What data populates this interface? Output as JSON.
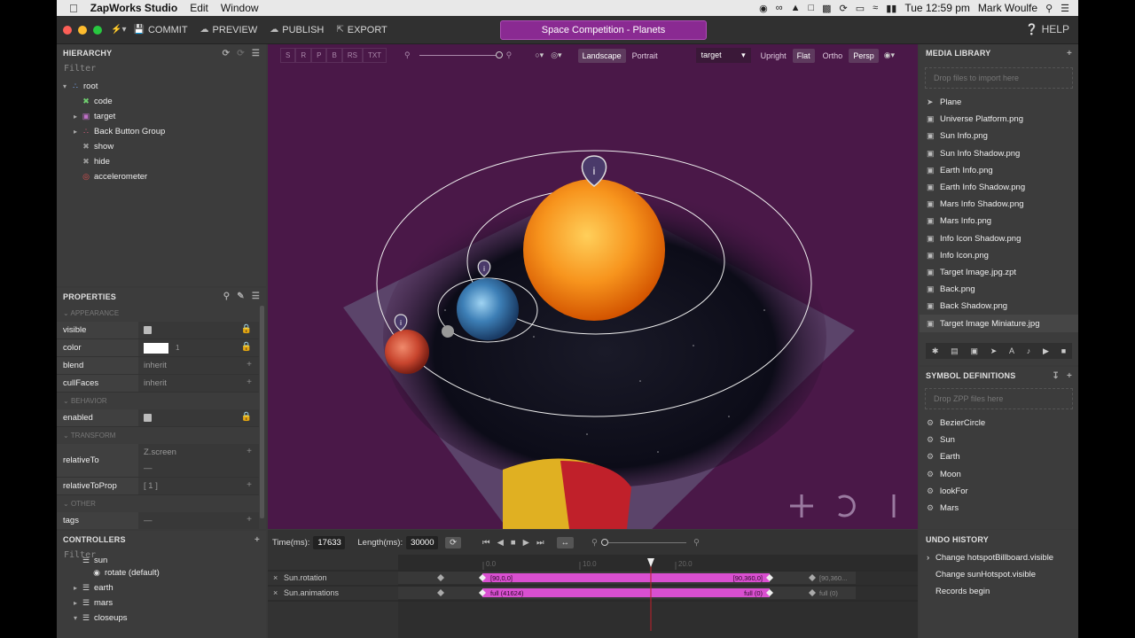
{
  "menubar": {
    "app_name": "ZapWorks Studio",
    "menus": [
      "Edit",
      "Window"
    ],
    "clock": "Tue 12:59 pm",
    "user": "Mark Woulfe"
  },
  "toolbar": {
    "commit": "COMMIT",
    "preview": "PREVIEW",
    "publish": "PUBLISH",
    "export": "EXPORT",
    "project_title": "Space Competition - Planets",
    "help": "HELP"
  },
  "hierarchy": {
    "title": "HIERARCHY",
    "filter": "Filter",
    "items": [
      {
        "label": "root",
        "icon": "group-icon",
        "color": "#7fb0ff",
        "indent": 0,
        "expanded": true
      },
      {
        "label": "code",
        "icon": "script-icon",
        "color": "#6fcf6f",
        "indent": 1
      },
      {
        "label": "target",
        "icon": "target-icon",
        "color": "#c070c8",
        "indent": 1,
        "collapsed": true
      },
      {
        "label": "Back Button Group",
        "icon": "group-icon",
        "color": "#e06080",
        "indent": 1,
        "collapsed": true
      },
      {
        "label": "show",
        "icon": "script-icon",
        "color": "#999999",
        "indent": 1
      },
      {
        "label": "hide",
        "icon": "script-icon",
        "color": "#999999",
        "indent": 1
      },
      {
        "label": "accelerometer",
        "icon": "sensor-icon",
        "color": "#e05050",
        "indent": 1
      }
    ]
  },
  "properties": {
    "title": "PROPERTIES",
    "appearance": "APPEARANCE",
    "visible": "visible",
    "color": "color",
    "color_value": "1",
    "blend": "blend",
    "blend_value": "inherit",
    "cullFaces": "cullFaces",
    "cullFaces_value": "inherit",
    "behavior": "BEHAVIOR",
    "enabled": "enabled",
    "transform": "TRANSFORM",
    "relativeTo": "relativeTo",
    "relativeTo_value": "Z.screen",
    "relativeTo_value2": "—",
    "relativeToProp": "relativeToProp",
    "relativeToProp_value": "[ 1 ]",
    "other": "OTHER",
    "tags": "tags",
    "tags_value": "—"
  },
  "controllers": {
    "title": "CONTROLLERS",
    "filter": "Filter",
    "items": [
      {
        "label": "sun",
        "indent": 1
      },
      {
        "label": "rotate (default)",
        "indent": 2
      },
      {
        "label": "earth",
        "indent": 1
      },
      {
        "label": "mars",
        "indent": 1
      },
      {
        "label": "closeups",
        "indent": 1
      }
    ]
  },
  "viewport": {
    "buttons_disabled": [
      "S",
      "R",
      "P",
      "B",
      "RS",
      "TXT"
    ],
    "landscape": "Landscape",
    "portrait": "Portrait",
    "target": "target",
    "upright": "Upright",
    "flat": "Flat",
    "ortho": "Ortho",
    "persp": "Persp"
  },
  "media": {
    "title": "MEDIA LIBRARY",
    "drop": "Drop files to import here",
    "items": [
      "Plane",
      "Universe Platform.png",
      "Sun Info.png",
      "Sun Info Shadow.png",
      "Earth Info.png",
      "Earth Info Shadow.png",
      "Mars Info Shadow.png",
      "Mars Info.png",
      "Info Icon Shadow.png",
      "Info Icon.png",
      "Target Image.jpg.zpt",
      "Back.png",
      "Back Shadow.png",
      "Target Image Miniature.jpg"
    ]
  },
  "symbols": {
    "title": "SYMBOL DEFINITIONS",
    "drop": "Drop ZPP files here",
    "items": [
      "BezierCircle",
      "Sun",
      "Earth",
      "Moon",
      "lookFor",
      "Mars"
    ]
  },
  "timeline": {
    "time_label": "Time(ms):",
    "time_value": "17633",
    "length_label": "Length(ms):",
    "length_value": "30000",
    "ticks": [
      "0.0",
      "10.0",
      "20.0"
    ],
    "tracks": [
      {
        "name": "Sun.rotation",
        "start_label": "[90,0,0]",
        "end_label": "[90,360,0]",
        "after_label": "[90,360..."
      },
      {
        "name": "Sun.animations",
        "start_label": "full (41624)",
        "end_label": "full (0)",
        "after_label": "full (0)"
      }
    ]
  },
  "undo": {
    "title": "UNDO HISTORY",
    "items": [
      "Change hotspotBillboard.visible",
      "Change sunHotspot.visible",
      "Records begin"
    ]
  }
}
